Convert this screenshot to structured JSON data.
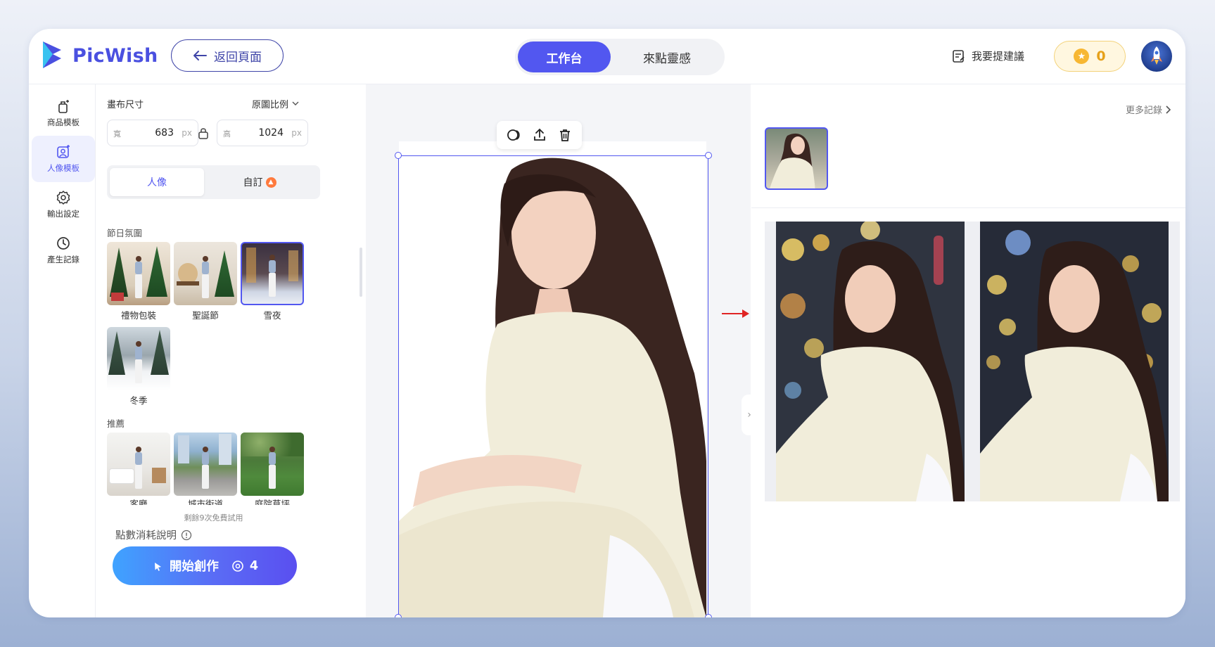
{
  "header": {
    "brand": "PicWish",
    "back_label": "返回頁面",
    "mode_tabs": [
      {
        "label": "工作台",
        "active": true
      },
      {
        "label": "來點靈感",
        "active": false
      }
    ],
    "suggest_label": "我要提建議",
    "coins": "0"
  },
  "sidebar": {
    "items": [
      {
        "label": "商品模板",
        "icon": "product-template-icon",
        "active": false
      },
      {
        "label": "人像模板",
        "icon": "portrait-template-icon",
        "active": true
      },
      {
        "label": "輸出設定",
        "icon": "gear-icon",
        "active": false
      },
      {
        "label": "產生記錄",
        "icon": "clock-icon",
        "active": false
      }
    ]
  },
  "settings": {
    "canvas_size_label": "畫布尺寸",
    "ratio_label": "原圖比例",
    "width": {
      "key": "寬",
      "value": "683",
      "unit": "px"
    },
    "height": {
      "key": "高",
      "value": "1024",
      "unit": "px"
    },
    "tabs": [
      {
        "label": "人像",
        "active": true
      },
      {
        "label": "自訂",
        "active": false
      }
    ],
    "section_holiday": "節日氛圍",
    "holiday_templates": [
      {
        "label": "禮物包裝",
        "selected": false
      },
      {
        "label": "聖誕節",
        "selected": false
      },
      {
        "label": "雪夜",
        "selected": true
      },
      {
        "label": "冬季",
        "selected": false
      }
    ],
    "section_recommend": "推薦",
    "recommend_templates": [
      {
        "label": "客廳"
      },
      {
        "label": "城市街道"
      },
      {
        "label": "庭院草坪"
      }
    ],
    "free_trials": "剩餘9次免費試用",
    "cost_info": "點數消耗說明",
    "create_label": "開始創作",
    "create_cost": "4"
  },
  "results": {
    "more_label": "更多記錄"
  },
  "colors": {
    "accent": "#5257f0",
    "brand": "#4a50e0",
    "coin": "#f7b733"
  }
}
